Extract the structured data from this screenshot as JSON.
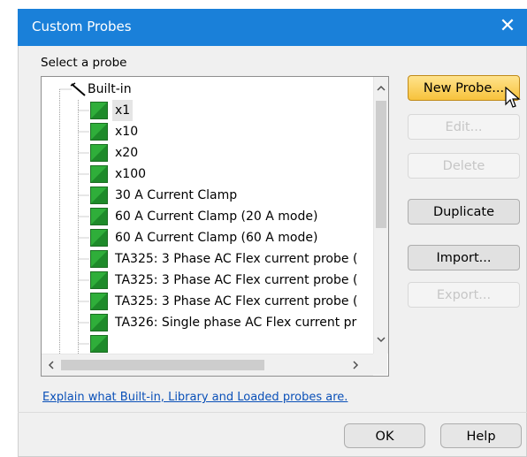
{
  "window": {
    "title": "Custom Probes",
    "close_glyph": "✕"
  },
  "probe_list": {
    "label": "Select a probe",
    "root_label": "Built-in",
    "items": [
      "x1",
      "x10",
      "x20",
      "x100",
      "30 A Current Clamp",
      "60 A Current Clamp (20 A mode)",
      "60 A Current Clamp (60 A mode)",
      "TA325: 3 Phase AC Flex current probe (",
      "TA325: 3 Phase AC Flex current probe (",
      "TA325: 3 Phase AC Flex current probe (",
      "TA326: Single phase AC Flex current pr"
    ]
  },
  "buttons": {
    "new_probe": "New Probe...",
    "edit": "Edit...",
    "delete": "Delete",
    "duplicate": "Duplicate",
    "import": "Import...",
    "export": "Export..."
  },
  "help_link": "Explain what Built-in, Library and Loaded probes are.",
  "footer": {
    "ok": "OK",
    "help": "Help"
  },
  "colors": {
    "title_bar": "#1a80d9",
    "primary_button": "#f7c23c",
    "link": "#0a50b8",
    "probe_icon": "#2fae3a"
  }
}
